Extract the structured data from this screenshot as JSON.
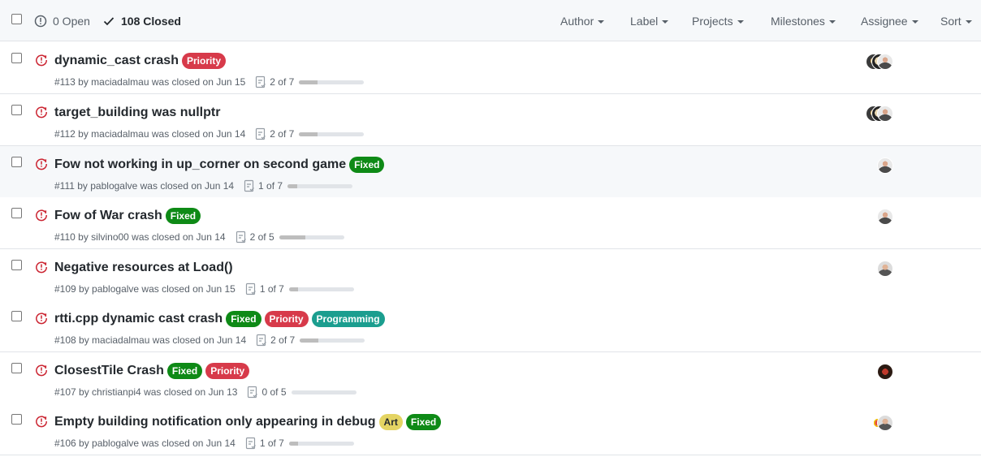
{
  "header": {
    "open_label": "0 Open",
    "closed_label": "108 Closed",
    "filters": [
      "Author",
      "Label",
      "Projects",
      "Milestones",
      "Assignee",
      "Sort"
    ]
  },
  "label_colors": {
    "Priority": "#d73a4a",
    "Fixed": "#0e8a16",
    "Programming": "#1b9e8f",
    "Art": "#e4d463"
  },
  "issues": [
    {
      "title": "dynamic_cast crash",
      "labels": [
        "Priority"
      ],
      "meta": "#113 by maciadalmau was closed on Jun 15",
      "progress": "2 of 7",
      "done": 2,
      "total": 7,
      "avatars": [
        "multi-1",
        "multi-2",
        "person"
      ]
    },
    {
      "title": "target_building was nullptr",
      "labels": [],
      "meta": "#112 by maciadalmau was closed on Jun 14",
      "progress": "2 of 7",
      "done": 2,
      "total": 7,
      "avatars": [
        "multi-1",
        "multi-2",
        "person"
      ]
    },
    {
      "title": "Fow not working in up_corner on second game",
      "labels": [
        "Fixed"
      ],
      "meta": "#111 by pablogalve was closed on Jun 14",
      "progress": "1 of 7",
      "done": 1,
      "total": 7,
      "avatars": [
        "person"
      ]
    },
    {
      "title": "Fow of War crash",
      "labels": [
        "Fixed"
      ],
      "meta": "#110 by silvino00 was closed on Jun 14",
      "progress": "2 of 5",
      "done": 2,
      "total": 5,
      "avatars": [
        "person"
      ]
    },
    {
      "title": "Negative resources at Load()",
      "labels": [],
      "meta": "#109 by pablogalve was closed on Jun 15",
      "progress": "1 of 7",
      "done": 1,
      "total": 7,
      "avatars": [
        "person-2"
      ]
    },
    {
      "title": "rtti.cpp dynamic cast crash",
      "labels": [
        "Fixed",
        "Priority",
        "Programming"
      ],
      "meta": "#108 by maciadalmau was closed on Jun 14",
      "progress": "2 of 7",
      "done": 2,
      "total": 7,
      "avatars": []
    },
    {
      "title": "ClosestTile Crash",
      "labels": [
        "Fixed",
        "Priority"
      ],
      "meta": "#107 by christianpi4 was closed on Jun 13",
      "progress": "0 of 5",
      "done": 0,
      "total": 5,
      "avatars": [
        "red-avatar"
      ]
    },
    {
      "title": "Empty building notification only appearing in debug",
      "labels": [
        "Art",
        "Fixed"
      ],
      "meta": "#106 by pablogalve was closed on Jun 14",
      "progress": "1 of 7",
      "done": 1,
      "total": 7,
      "avatars": [
        "multi-red",
        "person-2"
      ]
    }
  ]
}
